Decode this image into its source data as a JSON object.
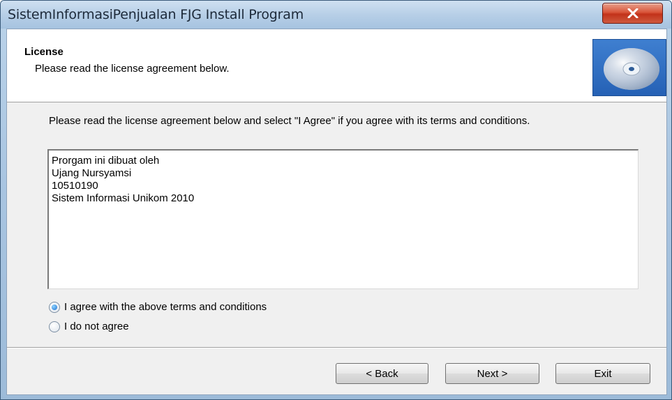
{
  "window": {
    "title": "SistemInformasiPenjualan FJG Install Program"
  },
  "header": {
    "title": "License",
    "subtitle": "Please read the license agreement below."
  },
  "intro_text": "Please read the license agreement below and select \"I Agree\" if you agree with its terms and conditions.",
  "license_lines": [
    "Prorgam ini dibuat oleh",
    "Ujang Nursyamsi",
    "10510190",
    "Sistem Informasi Unikom 2010"
  ],
  "options": {
    "agree": {
      "label": "I agree with the above terms and conditions",
      "checked": true
    },
    "disagree": {
      "label": "I do not agree",
      "checked": false
    }
  },
  "buttons": {
    "back": "< Back",
    "next": "Next >",
    "exit": "Exit"
  },
  "icons": {
    "close": "close-icon",
    "cd": "cd-disc-icon"
  }
}
